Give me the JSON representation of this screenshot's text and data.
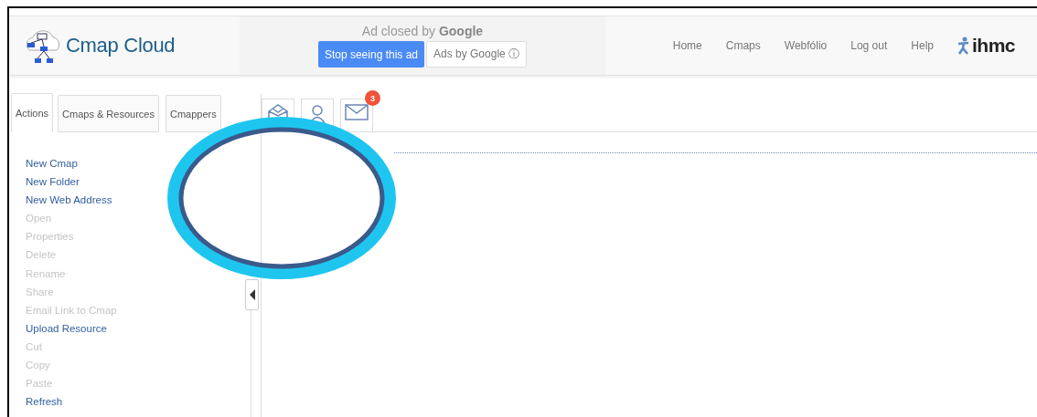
{
  "header": {
    "logo_text": "Cmap Cloud",
    "ad": {
      "notice_prefix": "Ad closed by",
      "notice_brand": "Google",
      "stop_button": "Stop seeing this ad",
      "ads_by": "Ads by Google ⓘ"
    },
    "nav": [
      "Home",
      "Cmaps",
      "Webfólio",
      "Log out",
      "Help"
    ],
    "brand": "ihmc"
  },
  "tabs": [
    {
      "label": "Actions",
      "selected": true
    },
    {
      "label": "Cmaps & Resources",
      "selected": false
    },
    {
      "label": "Cmappers",
      "selected": false
    }
  ],
  "toolbar": {
    "mail_badge": "3"
  },
  "actions": [
    {
      "label": "New Cmap",
      "disabled": false
    },
    {
      "label": "New Folder",
      "disabled": false
    },
    {
      "label": "New Web Address",
      "disabled": false
    },
    {
      "label": "Open",
      "disabled": true
    },
    {
      "label": "Properties",
      "disabled": true
    },
    {
      "label": "Delete",
      "disabled": true
    },
    {
      "label": "Rename",
      "disabled": true
    },
    {
      "label": "Share",
      "disabled": true
    },
    {
      "label": "Email Link to Cmap",
      "disabled": true
    },
    {
      "label": "Upload Resource",
      "disabled": false
    },
    {
      "label": "Cut",
      "disabled": true
    },
    {
      "label": "Copy",
      "disabled": true
    },
    {
      "label": "Paste",
      "disabled": true
    },
    {
      "label": "Refresh",
      "disabled": false
    }
  ]
}
